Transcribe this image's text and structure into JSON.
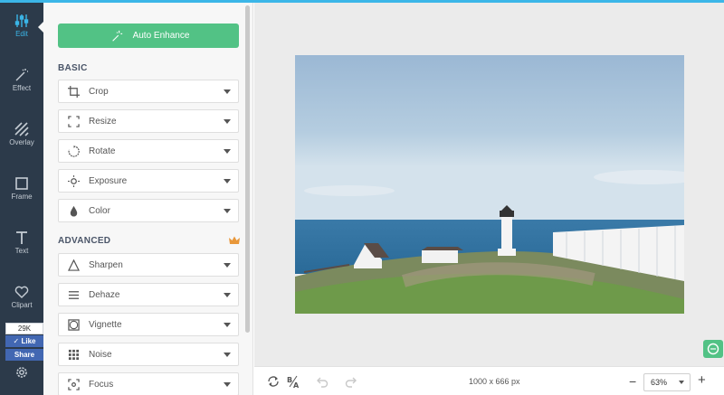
{
  "sidebar": {
    "items": [
      {
        "label": "Edit",
        "icon": "sliders-icon"
      },
      {
        "label": "Effect",
        "icon": "magic-wand-icon"
      },
      {
        "label": "Overlay",
        "icon": "stripes-icon"
      },
      {
        "label": "Frame",
        "icon": "frame-icon"
      },
      {
        "label": "Text",
        "icon": "text-icon"
      },
      {
        "label": "Clipart",
        "icon": "heart-icon"
      }
    ],
    "facebook": {
      "count": "29K",
      "like": "Like",
      "share": "Share"
    }
  },
  "panel": {
    "auto_enhance": "Auto Enhance",
    "basic_title": "BASIC",
    "basic_tools": [
      "Crop",
      "Resize",
      "Rotate",
      "Exposure",
      "Color"
    ],
    "advanced_title": "ADVANCED",
    "advanced_tools": [
      "Sharpen",
      "Dehaze",
      "Vignette",
      "Noise",
      "Focus"
    ]
  },
  "bottombar": {
    "dimensions": "1000 x 666 px",
    "zoom": "63%"
  },
  "colors": {
    "accent": "#3bb6e8",
    "green": "#52c285",
    "sidebar": "#2c3a4a",
    "premium": "#e8973a"
  }
}
